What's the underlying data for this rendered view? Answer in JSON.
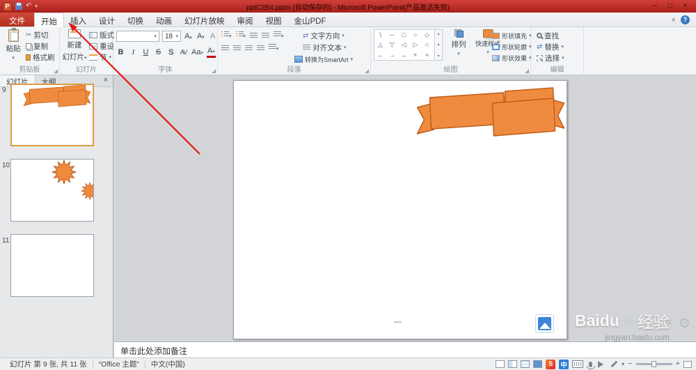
{
  "titlebar": {
    "app_initial": "P",
    "title": "pptC2B4.pptm [自动保存的] - Microsoft PowerPoint(产品激活失败)",
    "minimize": "─",
    "maximize": "□",
    "close": "×"
  },
  "tabs": {
    "file": "文件",
    "home": "开始",
    "insert": "插入",
    "design": "设计",
    "transitions": "切换",
    "animations": "动画",
    "slideshow": "幻灯片放映",
    "review": "审阅",
    "view": "视图",
    "pdf": "金山PDF",
    "help": "?",
    "collapse": "∧"
  },
  "ribbon": {
    "clipboard": {
      "label": "剪贴板",
      "paste": "粘贴",
      "cut": "剪切",
      "copy": "复制",
      "format_painter": "格式刷"
    },
    "slides": {
      "label": "幻灯片",
      "new_slide_line1": "新建",
      "new_slide_line2": "幻灯片",
      "layout": "版式",
      "reset": "重设",
      "section": "节"
    },
    "font": {
      "label": "字体",
      "size": "18",
      "bold": "B",
      "italic": "I",
      "underline": "U",
      "strike": "S",
      "shadow": "S",
      "spacing": "AV",
      "case": "Aa",
      "color": "A"
    },
    "paragraph": {
      "label": "段落",
      "text_direction": "文字方向",
      "align_text": "对齐文本",
      "smartart": "转换为SmartArt"
    },
    "drawing": {
      "label": "绘图",
      "arrange": "排列",
      "quick_styles": "快速样式",
      "shape_fill": "形状填充",
      "shape_outline": "形状轮廓",
      "shape_effects": "形状效果",
      "shapes": [
        "∖",
        "─",
        "□",
        "○",
        "◇",
        "△",
        "▽",
        "◁",
        "▷",
        "☆",
        "←",
        "→",
        "↔",
        "+",
        "≈"
      ]
    },
    "editing": {
      "label": "编辑",
      "find": "查找",
      "replace": "替换",
      "select": "选择"
    }
  },
  "slide_panel": {
    "slides_tab": "幻灯片",
    "outline_tab": "大纲",
    "close": "×",
    "thumb1_number": "9",
    "thumb2_number": "10",
    "thumb3_number": "11"
  },
  "slide": {
    "footer_dash": "—"
  },
  "notes": {
    "placeholder": "单击此处添加备注"
  },
  "status_bar": {
    "slide_info": "幻灯片 第 9 张, 共 11 张",
    "theme": "“Office 主题”",
    "language": "中文(中国)",
    "sogou": "S",
    "cn": "中"
  },
  "watermark": {
    "brand_left": "Baidu",
    "brand_right": "经验",
    "url": "jingyan.baidu.com"
  },
  "colors": {
    "titlebar_red": "#bc2b24",
    "accent_orange": "#EE8B3E",
    "shape_outline": "#BE5E1B",
    "annotation_red": "#e11a12"
  }
}
